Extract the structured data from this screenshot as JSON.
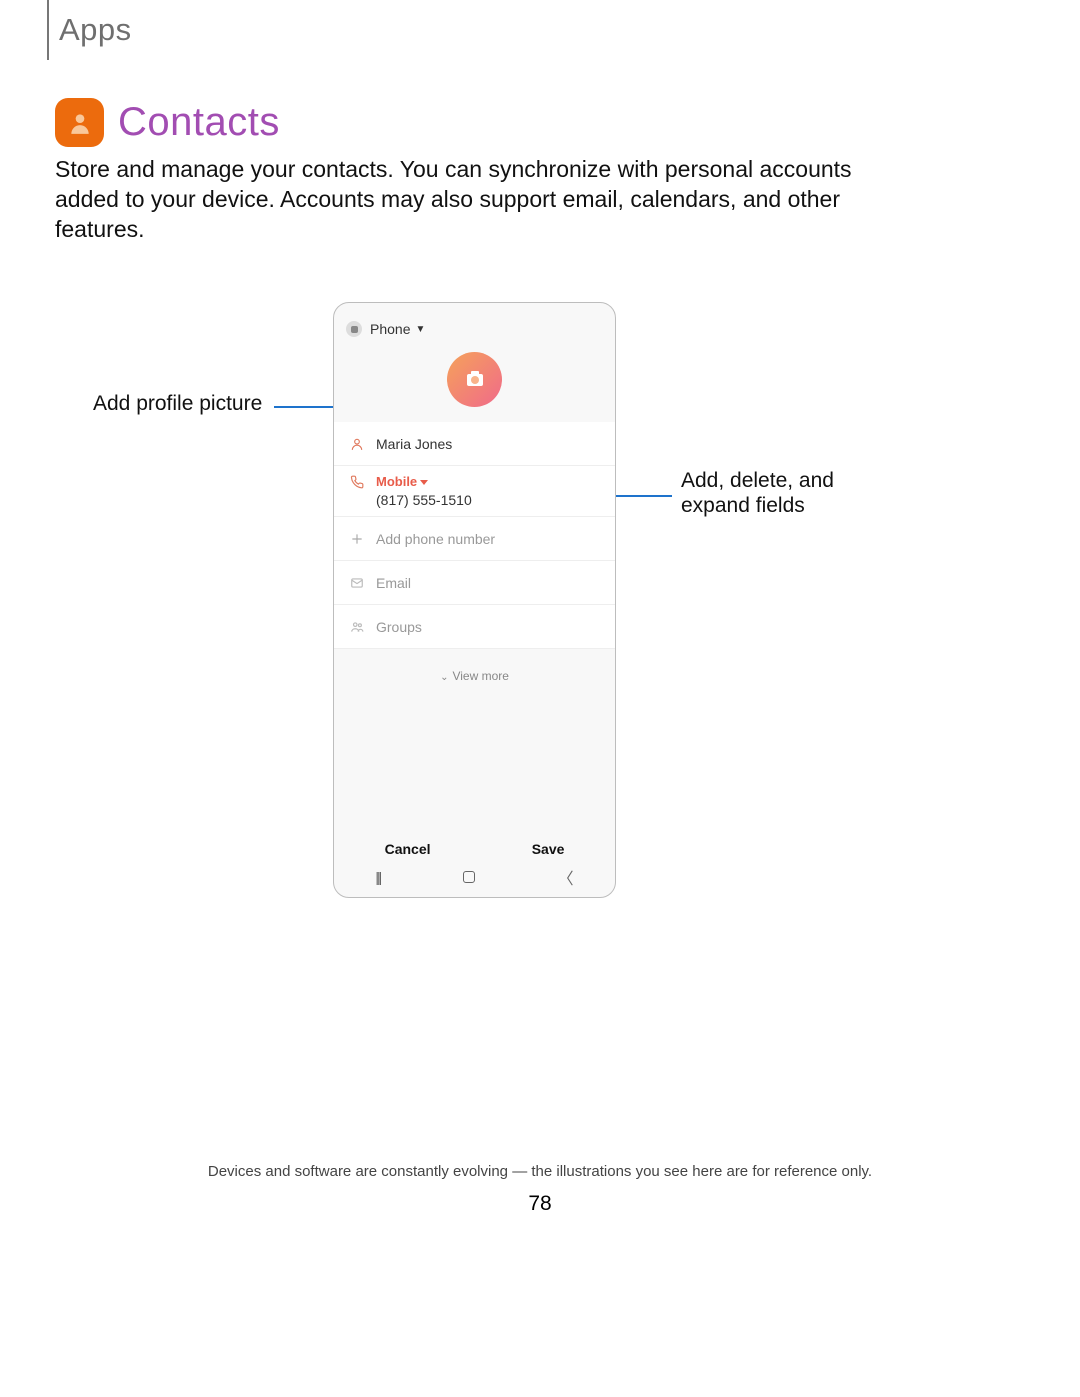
{
  "header": {
    "tab": "Apps"
  },
  "title": "Contacts",
  "description": "Store and manage your contacts. You can synchronize with personal accounts added to your device. Accounts may also support email, calendars, and other features.",
  "callouts": {
    "left": "Add profile picture",
    "right": "Add, delete, and expand fields"
  },
  "phone": {
    "storage_label": "Phone",
    "name": "Maria Jones",
    "phone_type": "Mobile",
    "phone_number": "(817) 555-1510",
    "add_phone": "Add phone number",
    "email": "Email",
    "groups": "Groups",
    "view_more": "View more",
    "cancel": "Cancel",
    "save": "Save"
  },
  "footer": "Devices and software are constantly evolving — the illustrations you see here are for reference only.",
  "page_number": "78"
}
